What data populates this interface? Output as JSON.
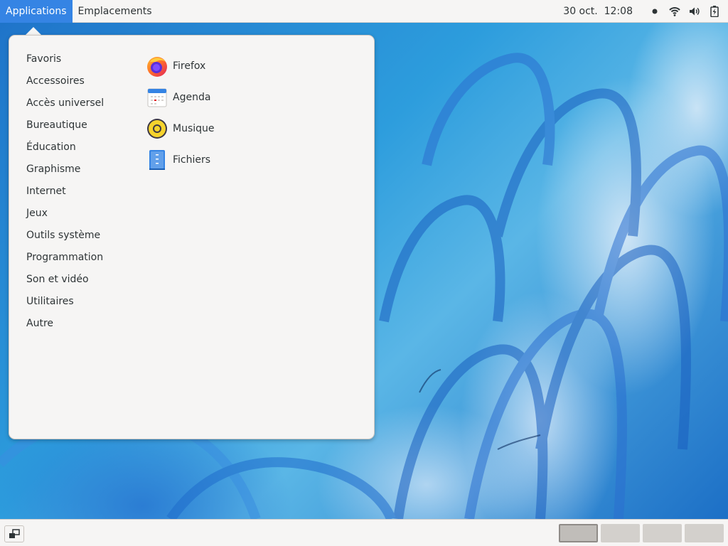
{
  "topbar": {
    "menus": [
      {
        "label": "Applications",
        "active": true
      },
      {
        "label": "Emplacements",
        "active": false
      }
    ],
    "clock": "30 oct.  12:08",
    "tray_icons": [
      "notification-dot-icon",
      "wifi-icon",
      "volume-icon",
      "battery-icon"
    ]
  },
  "app_menu": {
    "categories": [
      "Favoris",
      "Accessoires",
      "Accès universel",
      "Bureautique",
      "Éducation",
      "Graphisme",
      "Internet",
      "Jeux",
      "Outils système",
      "Programmation",
      "Son et vidéo",
      "Utilitaires",
      "Autre"
    ],
    "apps": [
      {
        "label": "Firefox",
        "icon": "firefox-icon"
      },
      {
        "label": "Agenda",
        "icon": "calendar-icon"
      },
      {
        "label": "Musique",
        "icon": "music-icon"
      },
      {
        "label": "Fichiers",
        "icon": "files-icon"
      }
    ]
  },
  "bottombar": {
    "workspaces": [
      {
        "active": true
      },
      {
        "active": false
      },
      {
        "active": false
      },
      {
        "active": false
      }
    ]
  },
  "colors": {
    "accent": "#3584e4",
    "panel_bg": "#f6f5f4",
    "text": "#2e3436"
  }
}
